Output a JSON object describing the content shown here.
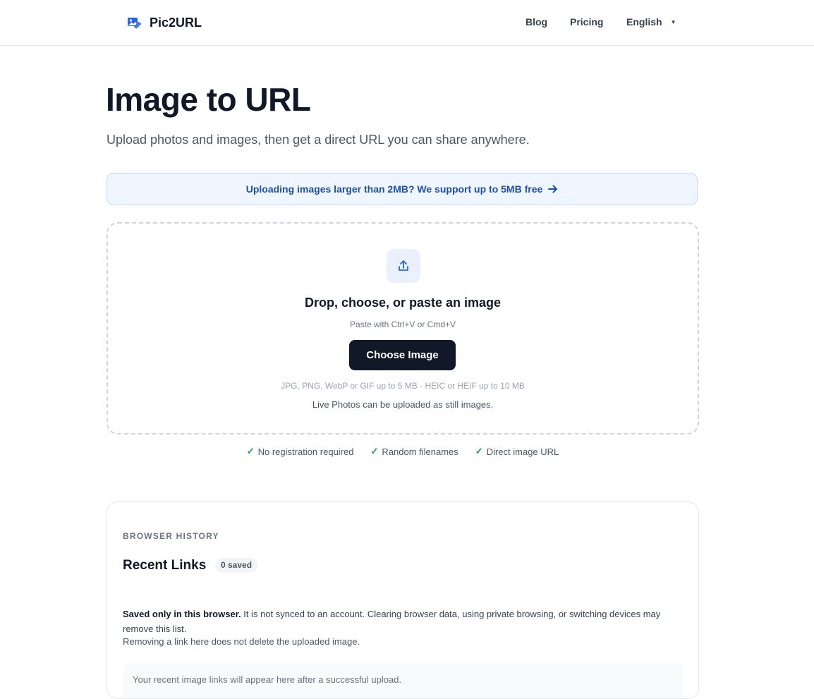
{
  "header": {
    "brand": "Pic2URL",
    "nav": {
      "blog": "Blog",
      "pricing": "Pricing",
      "language": "English"
    }
  },
  "hero": {
    "title": "Image to URL",
    "subtitle": "Upload photos and images, then get a direct URL you can share anywhere."
  },
  "banner": {
    "text": "Uploading images larger than 2MB? We support up to 5MB free"
  },
  "dropzone": {
    "title": "Drop, choose, or paste an image",
    "paste_hint": "Paste with Ctrl+V or Cmd+V",
    "button": "Choose Image",
    "formats": "JPG, PNG, WebP or GIF up to 5 MB · HEIC or HEIF up to 10 MB",
    "live_photos": "Live Photos can be uploaded as still images."
  },
  "features": [
    "No registration required",
    "Random filenames",
    "Direct image URL"
  ],
  "history": {
    "label": "BROWSER HISTORY",
    "title": "Recent Links",
    "badge": "0 saved",
    "note_bold": "Saved only in this browser.",
    "note_rest": " It is not synced to an account. Clearing browser data, using private browsing, or switching devices may remove this list.",
    "note2": "Removing a link here does not delete the uploaded image.",
    "empty": "Your recent image links will appear here after a successful upload."
  },
  "colors": {
    "accent": "#111827",
    "link": "#1e4fa8",
    "banner_bg": "#eff6ff",
    "check": "#16a34a"
  }
}
